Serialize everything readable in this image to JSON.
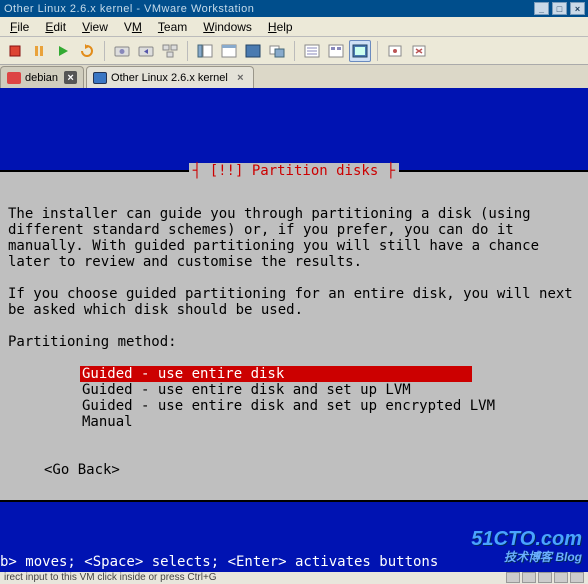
{
  "titlebar": {
    "text": "Other Linux 2.6.x kernel - VMware Workstation"
  },
  "menus": {
    "file": "File",
    "edit": "Edit",
    "view": "View",
    "vm": "VM",
    "team": "Team",
    "windows": "Windows",
    "help": "Help"
  },
  "tabs": [
    {
      "label": "debian",
      "active": false
    },
    {
      "label": "Other Linux 2.6.x kernel",
      "active": true
    }
  ],
  "installer": {
    "title": "[!!] Partition disks",
    "title_display": "┤ [!!] Partition disks ├",
    "para1": "The installer can guide you through partitioning a disk (using different standard schemes) or, if you prefer, you can do it manually. With guided partitioning you will still have a chance later to review and customise the results.",
    "para2": "If you choose guided partitioning for an entire disk, you will next be asked which disk should be used.",
    "prompt": "Partitioning method:",
    "options": [
      "Guided - use entire disk",
      "Guided - use entire disk and set up LVM",
      "Guided - use entire disk and set up encrypted LVM",
      "Manual"
    ],
    "selected_index": 0,
    "go_back": "<Go Back>"
  },
  "hints": "b> moves; <Space> selects; <Enter> activates buttons",
  "status": "irect input to this VM  click inside or press Ctrl+G",
  "watermark": {
    "main": "51CTO.com",
    "sub": "技术博客   Blog"
  },
  "icons": {
    "poweron": "power-on-icon",
    "poweroff": "power-off-icon",
    "suspend": "suspend-icon",
    "reset": "reset-icon",
    "snapshot": "snapshot-icon",
    "revert": "revert-icon",
    "manager": "snapshot-manager-icon",
    "fullscreen": "fullscreen-icon",
    "unity": "unity-icon",
    "quickswitch": "quick-switch-icon",
    "consoleview": "console-view-icon",
    "summary": "summary-icon",
    "cd": "cd-icon",
    "floppy": "floppy-icon",
    "network": "network-icon",
    "usb": "usb-icon",
    "sound": "sound-icon"
  }
}
